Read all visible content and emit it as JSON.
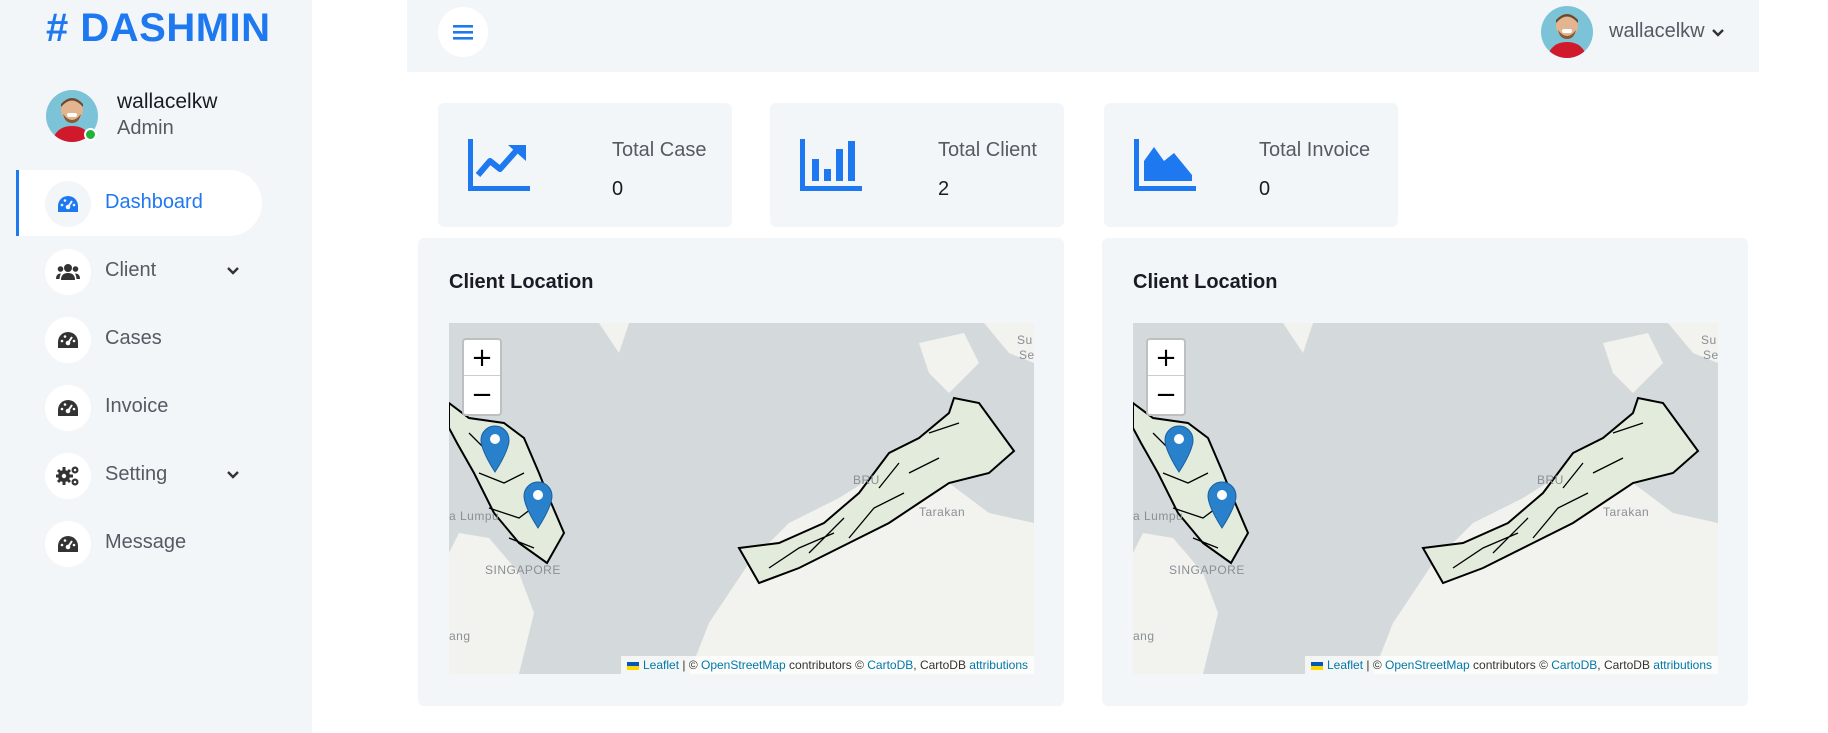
{
  "brand": {
    "hash": "#",
    "name": "DASHMIN"
  },
  "sidebar": {
    "profile": {
      "name": "wallacelkw",
      "role": "Admin"
    },
    "items": [
      {
        "label": "Dashboard",
        "icon": "dashboard-gauge-icon",
        "active": true
      },
      {
        "label": "Client",
        "icon": "users-icon",
        "has_submenu": true
      },
      {
        "label": "Cases",
        "icon": "dashboard-gauge-icon"
      },
      {
        "label": "Invoice",
        "icon": "dashboard-gauge-icon"
      },
      {
        "label": "Setting",
        "icon": "cogs-icon",
        "has_submenu": true
      },
      {
        "label": "Message",
        "icon": "dashboard-gauge-icon"
      }
    ]
  },
  "topbar": {
    "menu_icon": "hamburger-icon",
    "user": {
      "name": "wallacelkw"
    }
  },
  "stats": [
    {
      "label": "Total Case",
      "value": "0",
      "icon": "chart-line-icon"
    },
    {
      "label": "Total Client",
      "value": "2",
      "icon": "chart-bar-icon"
    },
    {
      "label": "Total Invoice",
      "value": "0",
      "icon": "chart-area-icon"
    }
  ],
  "maps": [
    {
      "title": "Client Location",
      "zoom_in": "+",
      "zoom_out": "−",
      "place_labels": {
        "singapore": "SINGAPORE",
        "lumpur": "a Lumpu",
        "brunei": "BRU",
        "tarakan": "Tarakan",
        "sulu": "Su",
        "sulu2": "Se",
        "batang": "ang"
      },
      "attribution": {
        "leaflet": "Leaflet",
        "sep1": " | © ",
        "osm": "OpenStreetMap",
        "contrib": " contributors © ",
        "carto": "CartoDB",
        "sep2": ", CartoDB ",
        "attr": "attributions"
      }
    },
    {
      "title": "Client Location",
      "zoom_in": "+",
      "zoom_out": "−",
      "place_labels": {
        "singapore": "SINGAPORE",
        "lumpur": "a Lumpu",
        "brunei": "BRU",
        "tarakan": "Tarakan",
        "sulu": "Su",
        "sulu2": "Se",
        "batang": "ang"
      },
      "attribution": {
        "leaflet": "Leaflet",
        "sep1": " | © ",
        "osm": "OpenStreetMap",
        "contrib": " contributors © ",
        "carto": "CartoDB",
        "sep2": ", CartoDB ",
        "attr": "attributions"
      }
    }
  ],
  "colors": {
    "accent": "#1e78f0",
    "panel": "#f3f6f9",
    "text": "#191c24",
    "muted": "#555a63",
    "online": "#1fb33a",
    "marker": "#2a81cb"
  }
}
